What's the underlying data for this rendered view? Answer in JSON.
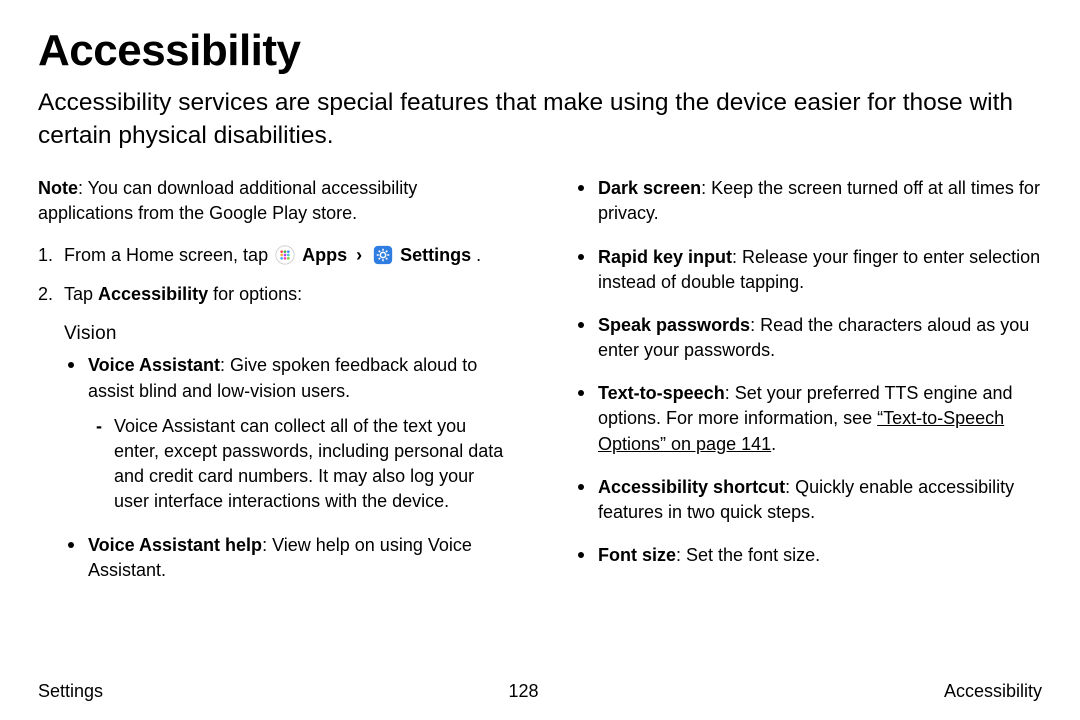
{
  "title": "Accessibility",
  "intro": "Accessibility services are special features that make using the device easier for those with certain physical disabilities.",
  "note": {
    "label": "Note",
    "text": ": You can download additional accessibility applications from the Google Play store."
  },
  "step1": {
    "prefix": "From a Home screen, tap ",
    "apps": "Apps",
    "settings": "Settings",
    "suffix": " ."
  },
  "step2": {
    "prefix": "Tap ",
    "bold": "Accessibility",
    "suffix": " for options:"
  },
  "vision_heading": "Vision",
  "vision": {
    "voice_assistant": {
      "title": "Voice Assistant",
      "text": ": Give spoken feedback aloud to assist blind and low-vision users.",
      "sub": "Voice Assistant can collect all of the text you enter, except passwords, including personal data and credit card numbers. It may also log your user interface interactions with the device."
    },
    "voice_assistant_help": {
      "title": "Voice Assistant help",
      "text": ": View help on using Voice Assistant."
    }
  },
  "right": {
    "dark_screen": {
      "title": "Dark screen",
      "text": ": Keep the screen turned off at all times for privacy."
    },
    "rapid_key": {
      "title": "Rapid key input",
      "text": ": Release your finger to enter selection instead of double tapping."
    },
    "speak_passwords": {
      "title": "Speak passwords",
      "text": ": Read the characters aloud as you enter your passwords."
    },
    "tts": {
      "title": "Text-to-speech",
      "text": ": Set your preferred TTS engine and options. For more information, see ",
      "link": "“Text-to-Speech Options” on page 141",
      "suffix": "."
    },
    "shortcut": {
      "title": "Accessibility shortcut",
      "text": ": Quickly enable accessibility features in two quick steps."
    },
    "font_size": {
      "title": "Font size",
      "text": ": Set the font size."
    }
  },
  "footer": {
    "left": "Settings",
    "center": "128",
    "right": "Accessibility"
  }
}
